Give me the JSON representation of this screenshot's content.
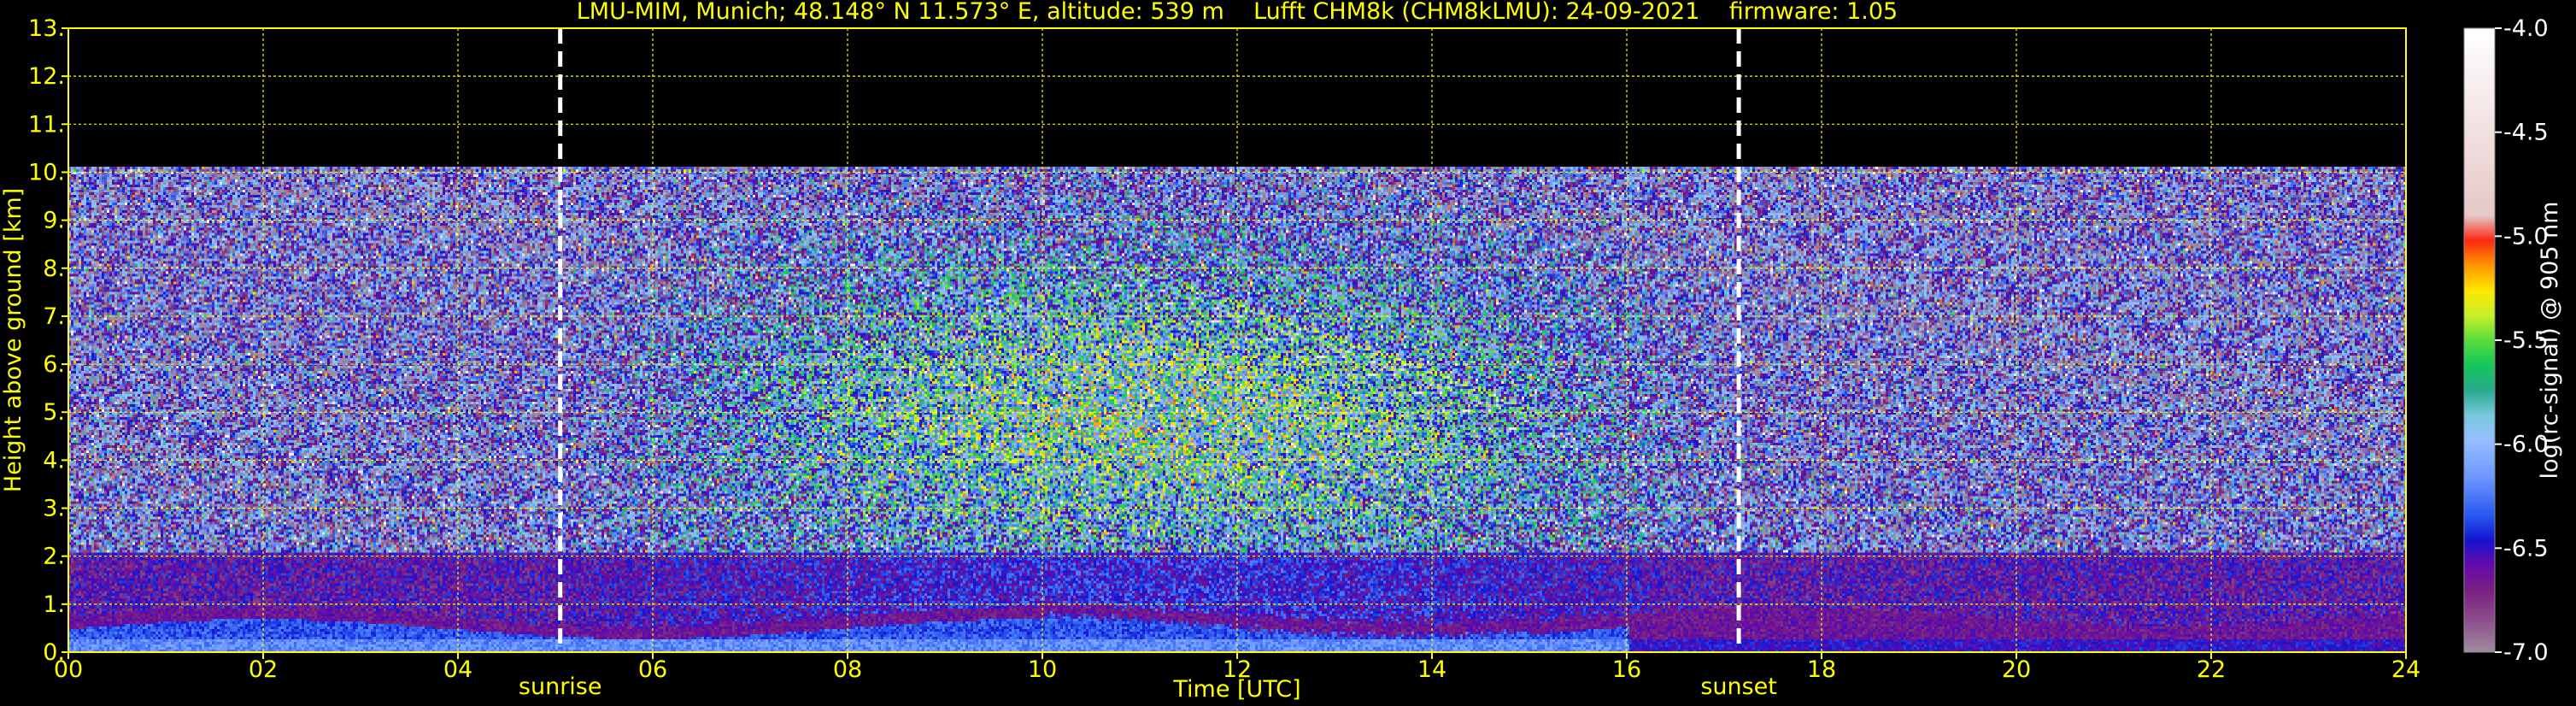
{
  "title": "LMU-MIM, Munich; 48.148° N 11.573° E, altitude: 539 m    Lufft CHM8k (CHM8kLMU): 24-09-2021    firmware: 1.05",
  "colors": {
    "background": "#000000",
    "text": "#ffff00",
    "grid": "#ffff00",
    "colorbar_text": "#ffffff",
    "markers": "#ffffff"
  },
  "chart_data": {
    "type": "heatmap",
    "title": "LMU-MIM, Munich; 48.148° N 11.573° E, altitude: 539 m    Lufft CHM8k (CHM8kLMU): 24-09-2021    firmware: 1.05",
    "xlabel": "Time [UTC]",
    "ylabel": "Height above ground [km]",
    "xlim": [
      0,
      24
    ],
    "ylim": [
      0,
      13
    ],
    "x_ticks": [
      0,
      2,
      4,
      6,
      8,
      10,
      12,
      14,
      16,
      18,
      20,
      22,
      24
    ],
    "x_tick_labels": [
      "00",
      "02",
      "04",
      "06",
      "08",
      "10",
      "12",
      "14",
      "16",
      "18",
      "20",
      "22",
      "24"
    ],
    "y_ticks": [
      0,
      1,
      2,
      3,
      4,
      5,
      6,
      7,
      8,
      9,
      10,
      11,
      12,
      13
    ],
    "y_tick_labels": [
      "0.",
      "1.",
      "2.",
      "3.",
      "4.",
      "5.",
      "6.",
      "7.",
      "8.",
      "9.",
      "10.",
      "11.",
      "12.",
      "13."
    ],
    "grid": true,
    "data_top_km": 10,
    "vertical_markers": [
      {
        "label": "sunrise",
        "x": 5.05
      },
      {
        "label": "sunset",
        "x": 17.15
      }
    ],
    "colorbar": {
      "label": "log(rc-signal) @ 905 nm",
      "range": [
        -7.0,
        -4.0
      ],
      "ticks": [
        -4.0,
        -4.5,
        -5.0,
        -5.5,
        -6.0,
        -6.5,
        -7.0
      ],
      "tick_labels": [
        "-4.0",
        "-4.5",
        "-5.0",
        "-5.5",
        "-6.0",
        "-6.5",
        "-7.0"
      ],
      "placement": "right"
    }
  }
}
